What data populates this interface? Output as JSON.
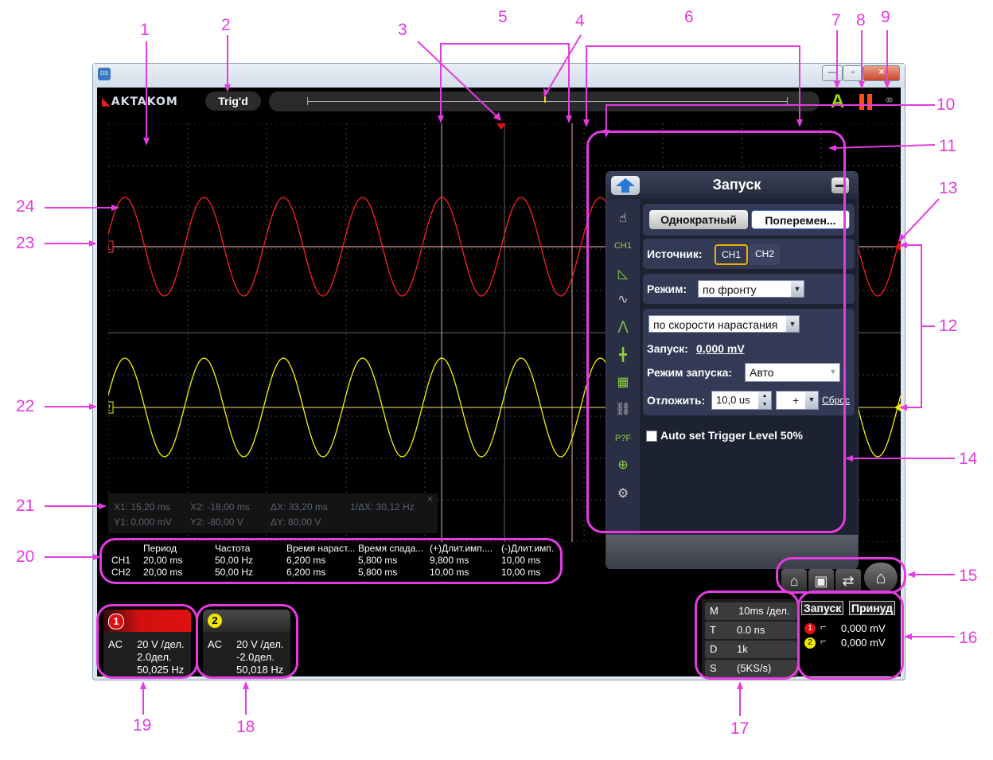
{
  "window": {
    "app_icon": "app-icon",
    "min_glyph": "—",
    "max_glyph": "▫",
    "close_glyph": "✕"
  },
  "toolbar": {
    "logo_text": "AKTAKOM",
    "status": "Trig'd",
    "icons": [
      "auto-a-icon",
      "pause-icon",
      "link-icon"
    ]
  },
  "cursor_info": {
    "close_glyph": "×",
    "x1": "X1: 15,20 ms",
    "x2": "X2: -18,00 ms",
    "dx": "ΔX: 33,20 ms",
    "inv_dx": "1/ΔX: 30,12 Hz",
    "y1": "Y1: 0,000 mV",
    "y2": "Y2: -80,00 V",
    "dy": "ΔY: 80,00 V"
  },
  "screen": {
    "ch1_marker": "1",
    "ch2_marker": "2",
    "ch1_color": "#ff1f1f",
    "ch2_color": "#f2f200",
    "grid_color": "#444444",
    "waveform": {
      "ch1_cycles_visible": 10,
      "ch2_cycles_visible": 10
    }
  },
  "trigger_panel": {
    "title": "Запуск",
    "single_button": "Однократный",
    "alternate_button": "Поперемен...",
    "source_label": "Источник:",
    "source_options": [
      "CH1",
      "CH2"
    ],
    "source_selected": "CH1",
    "mode_label": "Режим:",
    "mode_value": "по фронту",
    "slope_value": "по скорости нарастания",
    "level_label": "Запуск:",
    "level_value": "0,000 mV",
    "trigger_mode_label": "Режим запуска:",
    "trigger_mode_value": "Авто",
    "holdoff_label": "Отложить:",
    "holdoff_value": "10,0 us",
    "holdoff_unit_select": "+",
    "reset_link": "Сброс",
    "auto_level_label": "Auto set Trigger Level 50%",
    "auto_level_checked": false,
    "side_icons": [
      "touch-icon",
      "ch1-icon",
      "trigger-ruler-icon",
      "waveform-icon",
      "measure-waveform-icon",
      "cursor-icon",
      "math-icon",
      "link-icon",
      "pass-fail-icon",
      "zoom-icon",
      "settings-gear-icon"
    ]
  },
  "measurements": {
    "headers": [
      "Период",
      "Частота",
      "Время нараст...",
      "Время спада...",
      "(+)Длит.имп....",
      "(-)Длит.имп."
    ],
    "rows": [
      {
        "ch": "CH1",
        "values": [
          "20,00 ms",
          "50,00 Hz",
          "6,200 ms",
          "5,800 ms",
          "9,800 ms",
          "10,00 ms"
        ]
      },
      {
        "ch": "CH2",
        "values": [
          "20,00 ms",
          "50,00 Hz",
          "6,200 ms",
          "5,800 ms",
          "10,00 ms",
          "10,00 ms"
        ]
      }
    ]
  },
  "channels": [
    {
      "id": "1",
      "coupling": "AC",
      "volts_div": "20 V /дел.",
      "offset": "2.0дел.",
      "freq": "50,025 Hz",
      "color": "#e01010"
    },
    {
      "id": "2",
      "coupling": "AC",
      "volts_div": "20 V /дел.",
      "offset": "-2.0дел.",
      "freq": "50,018 Hz",
      "color": "#f2e600"
    }
  ],
  "timebase": {
    "m_label": "M",
    "m_value": "10ms /дел.",
    "t_label": "T",
    "t_value": "0.0 ns",
    "d_label": "D",
    "d_value": "1k",
    "s_label": "S",
    "s_value": "(5KS/s)"
  },
  "trigger_status": {
    "tab_trigger": "Запуск",
    "tab_force": "Принуд",
    "ch1_level": "0,000 mV",
    "ch2_level": "0,000 mV"
  },
  "bottom_tools": [
    "home-settings-icon",
    "save-icon",
    "swap-icon",
    "home-icon"
  ],
  "annotations": [
    "1",
    "2",
    "3",
    "4",
    "5",
    "6",
    "7",
    "8",
    "9",
    "10",
    "11",
    "12",
    "13",
    "14",
    "15",
    "16",
    "17",
    "18",
    "19",
    "20",
    "21",
    "22",
    "23",
    "24"
  ]
}
